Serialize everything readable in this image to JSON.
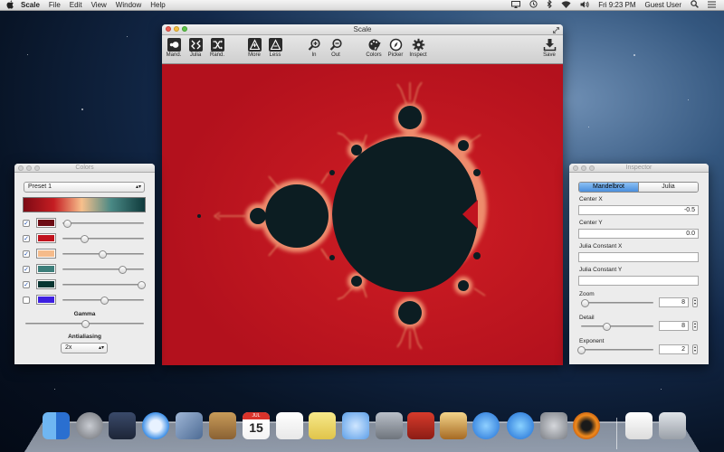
{
  "menubar": {
    "apple": "",
    "app_name": "Scale",
    "menus": [
      "File",
      "Edit",
      "View",
      "Window",
      "Help"
    ],
    "clock": "Fri 9:23 PM",
    "user": "Guest User"
  },
  "main_window": {
    "title": "Scale",
    "toolbar": {
      "mand": "Mand.",
      "julia": "Julia",
      "rand": "Rand.",
      "more": "More",
      "less": "Less",
      "in": "In",
      "out": "Out",
      "colors": "Colors",
      "picker": "Picker",
      "inspect": "Inspect",
      "save": "Save"
    },
    "fractal_colors": {
      "background": "#c1131f",
      "set": "#0c1d22",
      "glow": "#ffe39a"
    }
  },
  "colors_panel": {
    "title": "Colors",
    "preset": "Preset 1",
    "gradient": [
      "#7d0a14",
      "#c51d22",
      "#f7c08c",
      "#4a8985",
      "#0f3a3c"
    ],
    "rows": [
      {
        "checked": true,
        "color": "#6d0b14",
        "slider": 0.05
      },
      {
        "checked": true,
        "color": "#c0121d",
        "slider": 0.27
      },
      {
        "checked": true,
        "color": "#f5bb8b",
        "slider": 0.49
      },
      {
        "checked": true,
        "color": "#3c7e7a",
        "slider": 0.73
      },
      {
        "checked": true,
        "color": "#073531",
        "slider": 0.97
      },
      {
        "checked": false,
        "color": "#3d1fe0",
        "slider": 0.51
      }
    ],
    "gamma_label": "Gamma",
    "gamma": 0.5,
    "antialiasing_label": "Antialiasing",
    "antialiasing": "2x"
  },
  "inspector_panel": {
    "title": "Inspector",
    "mode_mandelbrot": "Mandelbrot",
    "mode_julia": "Julia",
    "center_x_label": "Center X",
    "center_x": "-0.5",
    "center_y_label": "Center Y",
    "center_y": "0.0",
    "julia_x_label": "Julia Constant X",
    "julia_x": "",
    "julia_y_label": "Julia Constant Y",
    "julia_y": "",
    "zoom_label": "Zoom",
    "zoom": "8",
    "zoom_slider": 0.05,
    "detail_label": "Detail",
    "detail": "8",
    "detail_slider": 0.35,
    "exponent_label": "Exponent",
    "exponent": "2",
    "exponent_slider": 0.0
  },
  "dock": {
    "icons": [
      "finder-icon",
      "launchpad-icon",
      "mission-control-icon",
      "safari-icon",
      "mail-icon",
      "contacts-icon",
      "calendar-icon",
      "reminders-icon",
      "notes-icon",
      "messages-icon",
      "facetime-icon",
      "photo-booth-icon",
      "iphoto-icon",
      "itunes-icon",
      "app-store-icon",
      "system-preferences-icon",
      "scale-app-icon",
      "documents-icon",
      "trash-icon"
    ],
    "calendar_day": "15",
    "calendar_month": "JUL"
  }
}
